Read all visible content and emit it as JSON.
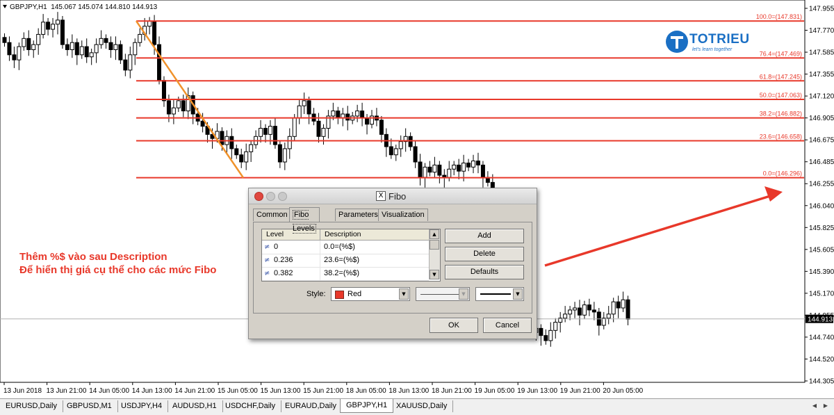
{
  "chart": {
    "symbol": "GBPJPY,H1",
    "ohlc": "145.067 145.074 144.810 144.913",
    "current_price": "144.913",
    "price_axis_labels": [
      "147.955",
      "147.770",
      "147.585",
      "147.355",
      "147.120",
      "146.905",
      "146.675",
      "146.485",
      "146.255",
      "146.040",
      "145.825",
      "145.605",
      "145.390",
      "145.170",
      "144.955",
      "144.740",
      "144.520",
      "144.305"
    ],
    "time_axis_labels": [
      "13 Jun 2018",
      "13 Jun 21:00",
      "14 Jun 05:00",
      "14 Jun 13:00",
      "14 Jun 21:00",
      "15 Jun 05:00",
      "15 Jun 13:00",
      "15 Jun 21:00",
      "18 Jun 05:00",
      "18 Jun 13:00",
      "18 Jun 21:00",
      "19 Jun 05:00",
      "19 Jun 13:00",
      "19 Jun 21:00",
      "20 Jun 05:00"
    ],
    "fibo_levels": [
      {
        "label": "100.0=(147.831)",
        "price": 147.831
      },
      {
        "label": "76.4=(147.469)",
        "price": 147.469
      },
      {
        "label": "61.8=(147.245)",
        "price": 147.245
      },
      {
        "label": "50.0=(147.063)",
        "price": 147.063
      },
      {
        "label": "38.2=(146.882)",
        "price": 146.882
      },
      {
        "label": "23.6=(146.658)",
        "price": 146.658
      },
      {
        "label": "0.0=(146.296)",
        "price": 146.296
      }
    ],
    "fibo_color": "#e8382a",
    "trend_color": "#f0922b"
  },
  "annotation": {
    "line1": "Thêm %$ vào sau Description",
    "line2": "Để hiển thị giá cụ thể cho các mức Fibo",
    "color": "#e8382a"
  },
  "logo": {
    "text": "TOTRIEU",
    "tagline": "let's learn together",
    "color": "#1a6fc4"
  },
  "dialog": {
    "title": "Fibo",
    "tabs": [
      "Common",
      "Fibo Levels",
      "Parameters",
      "Visualization"
    ],
    "active_tab": "Fibo Levels",
    "columns": [
      "Level",
      "Description"
    ],
    "rows": [
      {
        "level": "0",
        "description": "0.0=(%$)"
      },
      {
        "level": "0.236",
        "description": "23.6=(%$)"
      },
      {
        "level": "0.382",
        "description": "38.2=(%$)"
      }
    ],
    "buttons": {
      "add": "Add",
      "delete": "Delete",
      "defaults": "Defaults",
      "ok": "OK",
      "cancel": "Cancel"
    },
    "style_label": "Style:",
    "style_color_name": "Red",
    "style_color": "#e8382a"
  },
  "bottom_tabs": [
    "EURUSD,Daily",
    "GBPUSD,M1",
    "USDJPY,H4",
    "AUDUSD,H1",
    "USDCHF,Daily",
    "EURAUD,Daily",
    "GBPJPY,H1",
    "XAUUSD,Daily"
  ],
  "active_bottom_tab": "GBPJPY,H1"
}
